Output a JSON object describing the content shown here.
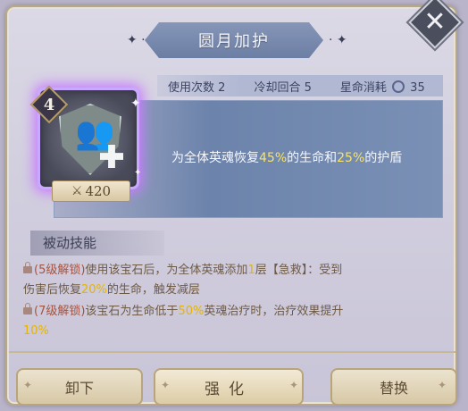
{
  "title": "圆月加护",
  "stats": {
    "uses_label": "使用次数",
    "uses_value": "2",
    "cooldown_label": "冷却回合",
    "cooldown_value": "5",
    "cost_label": "星命消耗",
    "cost_value": "35"
  },
  "gem": {
    "level": "4",
    "power": "420"
  },
  "description": {
    "part1": "为全体英魂恢复",
    "val1": "45%",
    "part2": "的生命和",
    "val2": "25%",
    "part3": "的护盾"
  },
  "passive": {
    "title": "被动技能",
    "line1": {
      "unlock": "(5级解锁)",
      "text_a": "使用该宝石后，为全体英魂添加",
      "num": "1",
      "text_b": "层【急救】：受到"
    },
    "line2": {
      "text_a": "伤害后恢复",
      "val": "20%",
      "text_b": "的生命，触发减层"
    },
    "line3": {
      "unlock": "(7级解锁)",
      "text_a": "该宝石为生命低于",
      "val": "50%",
      "text_b": "英魂治疗时，治疗效果提升"
    },
    "line4": {
      "val": "10%"
    }
  },
  "buttons": {
    "unequip": "卸下",
    "enhance": "强化",
    "replace": "替换"
  },
  "icons": {
    "close": "close-icon",
    "cost": "star-cost-icon",
    "lock": "lock-icon",
    "power": "crossed-swords-icon"
  },
  "colors": {
    "highlight": "#f8e36a",
    "unlock_red": "#a5533f",
    "passive_yellow": "#e6b400",
    "gem_glow": "#c77cff"
  }
}
